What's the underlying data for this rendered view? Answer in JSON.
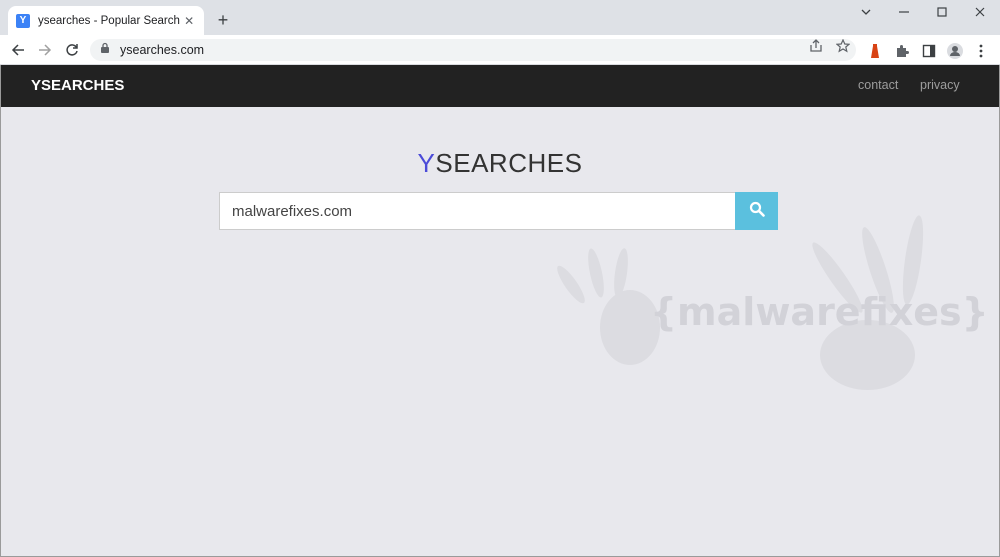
{
  "browser": {
    "tab_title": "ysearches - Popular Search Topics",
    "tab_favicon": "Y",
    "new_tab_label": "+",
    "url": "ysearches.com"
  },
  "site": {
    "brand": "YSEARCHES",
    "nav": {
      "contact": "contact",
      "privacy": "privacy"
    },
    "logo_first": "Y",
    "logo_rest": "SEARCHES",
    "search_value": "malwarefixes.com",
    "watermark": "{malwarefixes}"
  }
}
